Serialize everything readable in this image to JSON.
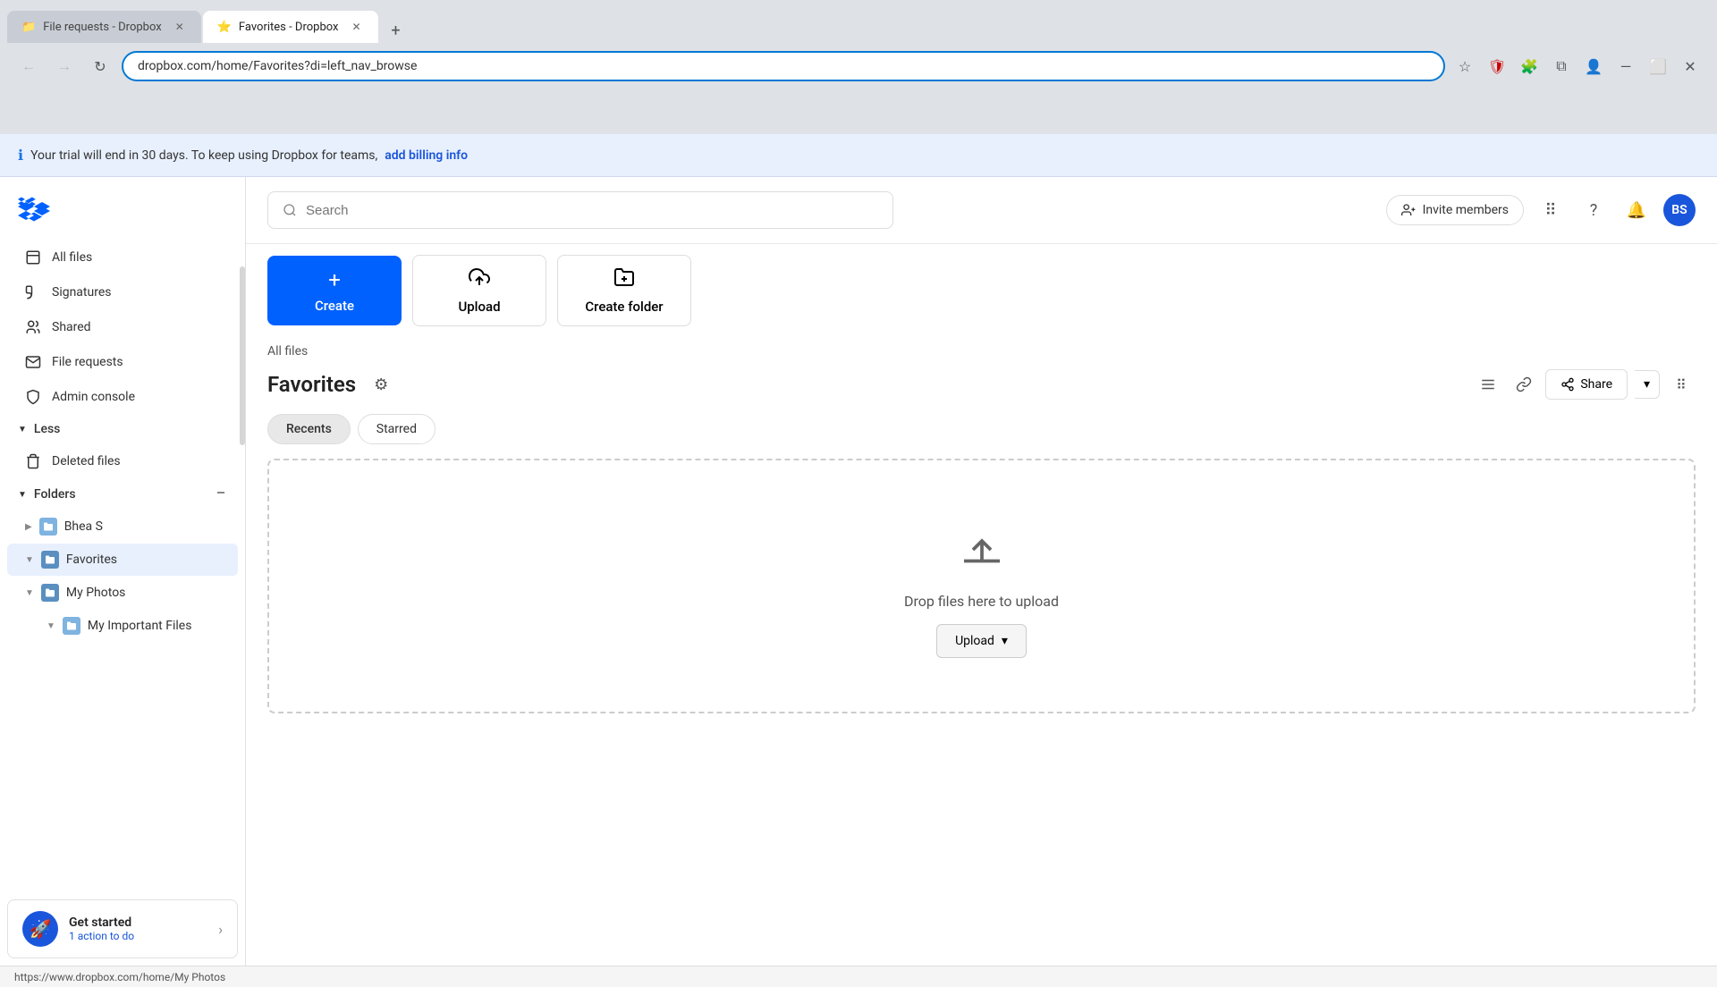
{
  "browser": {
    "tabs": [
      {
        "id": "tab1",
        "label": "File requests - Dropbox",
        "active": false,
        "favicon": "📁"
      },
      {
        "id": "tab2",
        "label": "Favorites - Dropbox",
        "active": true,
        "favicon": "⭐"
      }
    ],
    "new_tab_label": "+",
    "address": "dropbox.com/home/Favorites?di=left_nav_browse",
    "back_btn": "←",
    "forward_btn": "→",
    "refresh_btn": "↻"
  },
  "notification": {
    "message": "Your trial will end in 30 days. To keep using Dropbox for teams,",
    "link_text": "add billing info"
  },
  "sidebar": {
    "logo_alt": "Dropbox",
    "nav_items": [
      {
        "id": "all-files",
        "label": "All files",
        "icon": "files"
      },
      {
        "id": "signatures",
        "label": "Signatures",
        "icon": "pen"
      },
      {
        "id": "shared",
        "label": "Shared",
        "icon": "people"
      },
      {
        "id": "file-requests",
        "label": "File requests",
        "icon": "inbox"
      },
      {
        "id": "admin-console",
        "label": "Admin console",
        "icon": "shield"
      }
    ],
    "less_label": "Less",
    "deleted_files_label": "Deleted files",
    "folders_section": "Folders",
    "folders": [
      {
        "id": "bhea-s",
        "label": "Bhea S",
        "expanded": false
      },
      {
        "id": "favorites",
        "label": "Favorites",
        "expanded": true,
        "active": true
      },
      {
        "id": "my-photos",
        "label": "My Photos",
        "expanded": true,
        "active": false
      },
      {
        "id": "my-important-files",
        "label": "My Important Files",
        "expanded": false,
        "sub": true
      }
    ],
    "get_started": {
      "title": "Get started",
      "subtitle": "1 action to do",
      "icon": "🚀"
    }
  },
  "header": {
    "search_placeholder": "Search",
    "invite_btn": "Invite members",
    "avatar_initials": "BS"
  },
  "toolbar": {
    "create_label": "Create",
    "upload_label": "Upload",
    "create_folder_label": "Create folder"
  },
  "page": {
    "breadcrumb": "All files",
    "title": "Favorites",
    "tabs": [
      {
        "id": "recents",
        "label": "Recents",
        "active": true
      },
      {
        "id": "starred",
        "label": "Starred",
        "active": false
      }
    ],
    "drop_text": "Drop files here to upload",
    "upload_btn": "Upload",
    "share_btn": "Share"
  },
  "status_bar": {
    "url": "https://www.dropbox.com/home/My Photos"
  }
}
